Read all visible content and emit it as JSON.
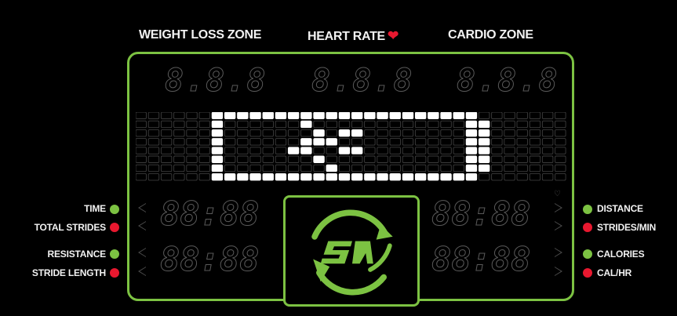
{
  "zones": {
    "weight_loss": "WEIGHT LOSS ZONE",
    "heart_rate": "HEART RATE",
    "cardio": "CARDIO ZONE"
  },
  "icons": {
    "heart": "heart-icon",
    "logo": "sa-logo"
  },
  "colors": {
    "accent_green": "#7cc242",
    "accent_red": "#e8182f",
    "background": "#000000"
  },
  "matrix_pattern": [
    "0000000000000000000000000000000000",
    "0000000000000000000000000000000000",
    "0000000000000000000000000000000000",
    "0000000000000000000000000000000000",
    "0000000000000000000000000000000000",
    "0000000000000000000000000000000000",
    "0000000000000000000000000000000000",
    "0000000000000000000000000000000000"
  ],
  "left_labels": [
    {
      "text": "TIME",
      "color": "green"
    },
    {
      "text": "TOTAL STRIDES",
      "color": "red"
    },
    {
      "text": "RESISTANCE",
      "color": "green"
    },
    {
      "text": "STRIDE LENGTH",
      "color": "red"
    }
  ],
  "right_labels": [
    {
      "text": "DISTANCE",
      "color": "green"
    },
    {
      "text": "STRIDES/MIN",
      "color": "red"
    },
    {
      "text": "CALORIES",
      "color": "green"
    },
    {
      "text": "CAL/HR",
      "color": "red"
    }
  ],
  "displays": {
    "top_left": "8.8.8",
    "top_center": "8.8.8",
    "top_right": "8.8.8",
    "mid_left": "88:88",
    "mid_right": "88:88",
    "low_left": "88:88",
    "low_right": "88:88"
  }
}
